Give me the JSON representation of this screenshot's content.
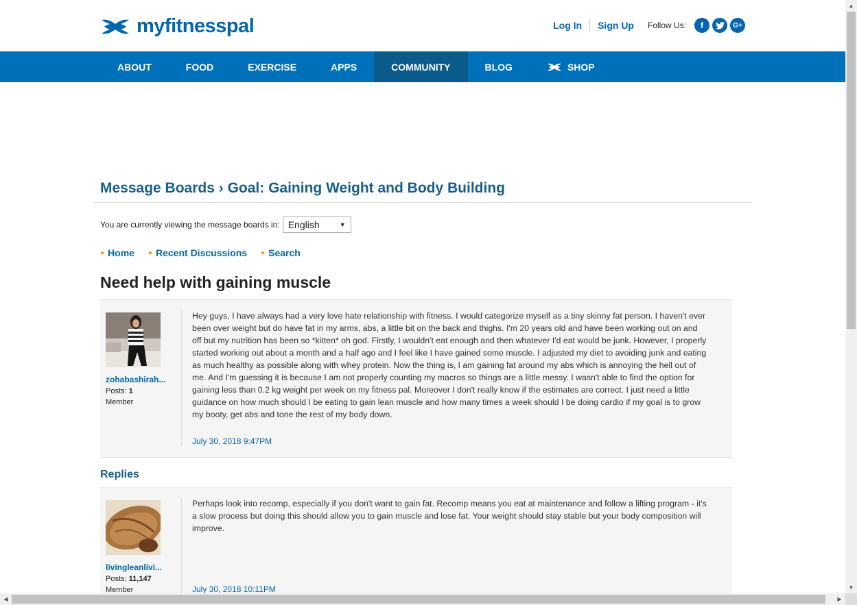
{
  "brand": {
    "name": "myfitnesspal",
    "color": "#0066b2"
  },
  "header": {
    "login": "Log In",
    "signup": "Sign Up",
    "follow": "Follow Us:",
    "social": [
      {
        "icon": "facebook-icon",
        "glyph": "f"
      },
      {
        "icon": "twitter-icon",
        "glyph": "t"
      },
      {
        "icon": "google-plus-icon",
        "glyph": "G+"
      }
    ]
  },
  "nav": {
    "items": [
      "ABOUT",
      "FOOD",
      "EXERCISE",
      "APPS",
      "COMMUNITY",
      "BLOG",
      "SHOP"
    ],
    "active": "COMMUNITY"
  },
  "board": {
    "title": "Message Boards › Goal: Gaining Weight and Body Building"
  },
  "language": {
    "label": "You are currently viewing the message boards in:",
    "selected": "English"
  },
  "crumbs": [
    "Home",
    "Recent Discussions",
    "Search"
  ],
  "topic": {
    "title": "Need help with gaining muscle"
  },
  "posts": [
    {
      "username": "zohabashirah...",
      "posts_label": "Posts:",
      "posts_count": "1",
      "role": "Member",
      "body": "Hey guys, I have always had a very love hate relationship with fitness. I would categorize myself as a tiny skinny fat person. I haven't ever been over weight but do have fat in my arms, abs, a little bit on the back and thighs. I'm 20 years old and have been working out on and off but my nutrition has been so *kitten* oh god. Firstly, I wouldn't eat enough and then whatever I'd eat would be junk. However, I properly started working out about a month and a half ago and I feel like I have gained some muscle. I adjusted my diet to avoiding junk and eating as much healthy as possible along with whey protein. Now the thing is, I am gaining fat around my abs which is annoying the hell out of me. And I'm guessing it is because I am not properly counting my macros so things are a little messy. I wasn't able to find the option for gaining less than 0.2 kg weight per week on my fitness pal. Moreover I don't really know if the estimates are correct. I just need a little guidance on how much should I be eating to gain lean muscle and how many times a week should I be doing cardio if my goal is to grow my booty, get abs and tone the rest of my body down.",
      "date": "July 30, 2018 9:47PM"
    }
  ],
  "replies": {
    "heading": "Replies",
    "items": [
      {
        "username": "livingleanlivi...",
        "posts_label": "Posts:",
        "posts_count": "11,147",
        "role": "Member",
        "body": "Perhaps look into recomp, especially if you don't want to gain fat. Recomp means you eat at maintenance and follow a lifting program - it's a slow process but doing this should allow you to gain muscle and lose fat. Your weight should stay stable but your body composition will improve.",
        "date": "July 30, 2018 10:11PM"
      }
    ]
  }
}
